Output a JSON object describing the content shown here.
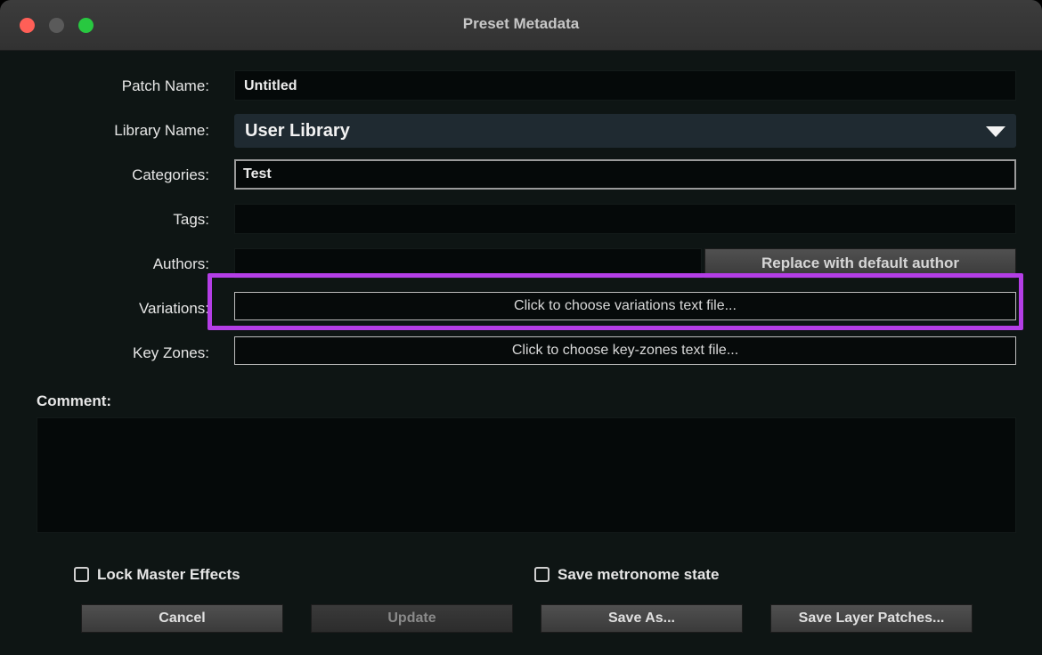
{
  "window": {
    "title": "Preset Metadata"
  },
  "form": {
    "patch_name": {
      "label": "Patch Name:",
      "value": "Untitled"
    },
    "library_name": {
      "label": "Library Name:",
      "value": "User Library"
    },
    "categories": {
      "label": "Categories:",
      "value": "Test"
    },
    "tags": {
      "label": "Tags:",
      "value": ""
    },
    "authors": {
      "label": "Authors:",
      "value": "",
      "button": "Replace with default author"
    },
    "variations": {
      "label": "Variations:",
      "button": "Click to choose variations text file..."
    },
    "key_zones": {
      "label": "Key Zones:",
      "button": "Click to choose key-zones text file..."
    },
    "comment": {
      "label": "Comment:",
      "value": ""
    }
  },
  "options": {
    "lock_master_effects": {
      "label": "Lock Master Effects",
      "checked": false
    },
    "save_metronome_state": {
      "label": "Save metronome state",
      "checked": false
    }
  },
  "buttons": {
    "cancel": "Cancel",
    "update": "Update",
    "save_as": "Save As...",
    "save_layer_patches": "Save Layer Patches..."
  },
  "colors": {
    "highlight": "#b43ee6",
    "window_bg": "#0e1514",
    "close": "#ff5f57",
    "maximize": "#28c840"
  }
}
